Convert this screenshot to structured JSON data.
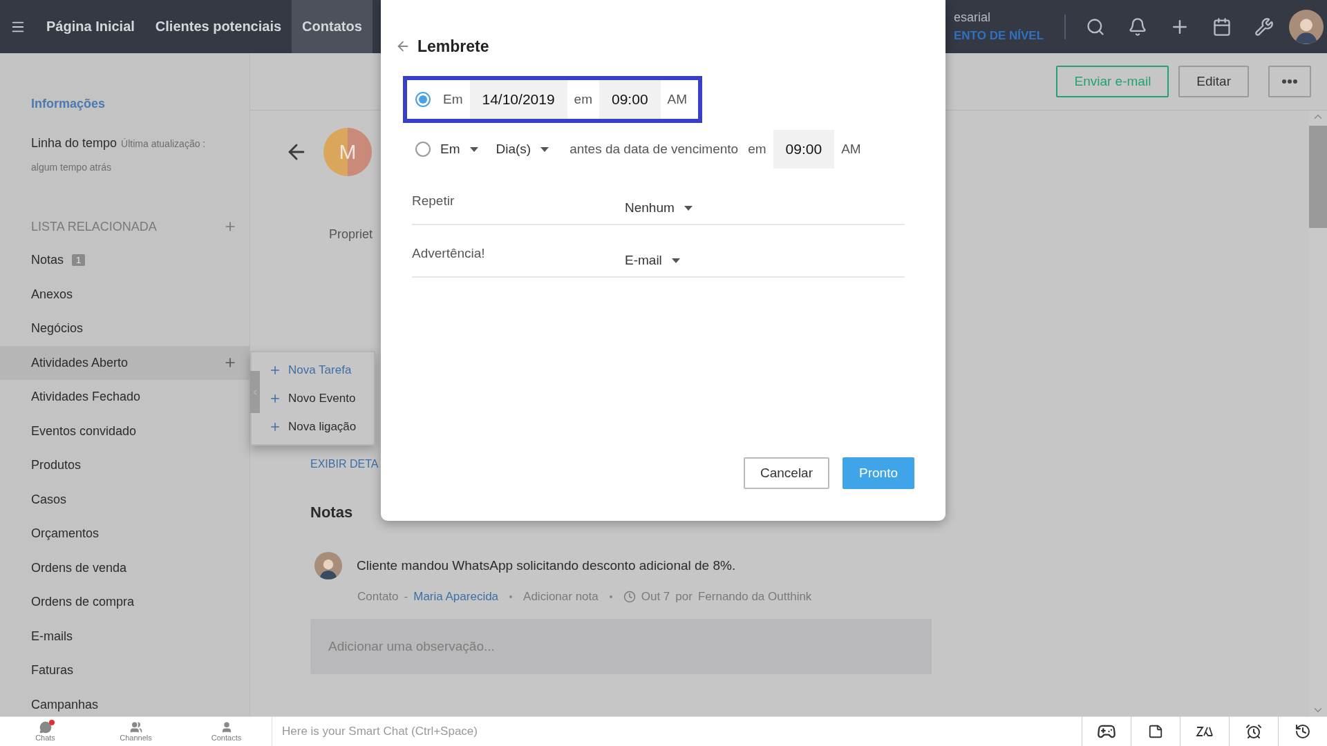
{
  "topbar": {
    "nav": [
      {
        "label": "Página Inicial",
        "selected": false
      },
      {
        "label": "Clientes potenciais",
        "selected": false
      },
      {
        "label": "Contatos",
        "selected": true
      }
    ],
    "org": {
      "name": "esarial",
      "action": "ENTO DE NÍVEL"
    }
  },
  "sidebar": {
    "info_link": "Informações",
    "timeline": {
      "label": "Linha do tempo",
      "updated": "Última atualização :",
      "time": "algum tempo atrás"
    },
    "related_header": "LISTA RELACIONADA",
    "items": [
      {
        "label": "Notas",
        "badge": "1",
        "selected": false
      },
      {
        "label": "Anexos",
        "selected": false
      },
      {
        "label": "Negócios",
        "selected": false
      },
      {
        "label": "Atividades Aberto",
        "selected": true
      },
      {
        "label": "Atividades Fechado",
        "selected": false
      },
      {
        "label": "Eventos convidado",
        "selected": false
      },
      {
        "label": "Produtos",
        "selected": false
      },
      {
        "label": "Casos",
        "selected": false
      },
      {
        "label": "Orçamentos",
        "selected": false
      },
      {
        "label": "Ordens de venda",
        "selected": false
      },
      {
        "label": "Ordens de compra",
        "selected": false
      },
      {
        "label": "E-mails",
        "selected": false
      },
      {
        "label": "Faturas",
        "selected": false
      },
      {
        "label": "Campanhas",
        "selected": false
      }
    ]
  },
  "popup_menu": [
    {
      "label": "Nova Tarefa",
      "selected": true
    },
    {
      "label": "Novo Evento",
      "selected": false
    },
    {
      "label": "Nova ligação",
      "selected": false
    }
  ],
  "actions": [
    {
      "kind": "email",
      "label": "Enviar e-mail"
    },
    {
      "kind": "plain",
      "label": "Editar"
    },
    {
      "kind": "more"
    }
  ],
  "record": {
    "avatar_letter": "M",
    "owner_fragment": "Propriet",
    "details_link": "EXIBIR DETA",
    "notes_title": "Notas",
    "note": {
      "text": "Cliente mandou WhatsApp solicitando desconto adicional de 8%.",
      "module": "Contato",
      "separator": "-",
      "contact": "Maria Aparecida",
      "action": "Adicionar nota",
      "date": "Out 7",
      "by": "por",
      "author": "Fernando da Outthink"
    },
    "add_note": {
      "placeholder": "Adicionar uma observação..."
    }
  },
  "modal": {
    "title": "Lembrete",
    "options": [
      {
        "kind": "date",
        "selected": true,
        "highlighted": true,
        "prefix": "Em",
        "date": "14/10/2019",
        "connector": "em",
        "time": "09:00",
        "meridiem": "AM"
      },
      {
        "kind": "relative",
        "selected": false,
        "highlighted": false,
        "prefix": "Em",
        "unit": "Dia(s)",
        "text": "antes da data de vencimento",
        "connector": "em",
        "time": "09:00",
        "meridiem": "AM"
      }
    ],
    "fields": [
      {
        "label": "Repetir",
        "value": "Nenhum"
      },
      {
        "label": "Advertência!",
        "value": "E-mail"
      }
    ],
    "buttons": [
      {
        "kind": "secondary",
        "label": "Cancelar"
      },
      {
        "kind": "primary",
        "label": "Pronto"
      }
    ]
  },
  "chat_bar": {
    "tabs": [
      {
        "kind": "chats",
        "label": "Chats",
        "notification": true
      },
      {
        "kind": "channels",
        "label": "Channels",
        "notification": false
      },
      {
        "kind": "contacts",
        "label": "Contacts",
        "notification": false
      }
    ],
    "placeholder": "Here is your Smart Chat (Ctrl+Space)"
  }
}
